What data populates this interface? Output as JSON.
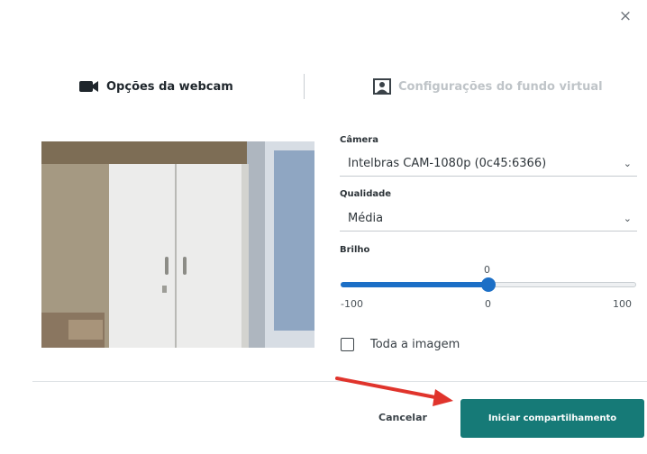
{
  "dialog": {
    "close_symbol": "×",
    "tabs": [
      {
        "label": "Opções da webcam",
        "icon": "video-camera-icon",
        "active": true
      },
      {
        "label": "Configurações do fundo virtual",
        "icon": "virtual-background-icon",
        "active": false
      }
    ]
  },
  "settings": {
    "camera": {
      "label": "Câmera",
      "value": "Intelbras CAM-1080p (0c45:6366)"
    },
    "quality": {
      "label": "Qualidade",
      "value": "Média"
    },
    "brightness": {
      "label": "Brilho",
      "value": "0",
      "min": "-100",
      "max": "100",
      "mid": "0",
      "fraction": 0.5
    },
    "full_image": {
      "label": "Toda a imagem",
      "checked": false
    }
  },
  "footer": {
    "cancel_label": "Cancelar",
    "primary_label": "Iniciar compartilhamento"
  },
  "colors": {
    "accent": "#1c6fc6",
    "primary_button": "#167a77",
    "annotation_arrow": "#e0342c"
  }
}
